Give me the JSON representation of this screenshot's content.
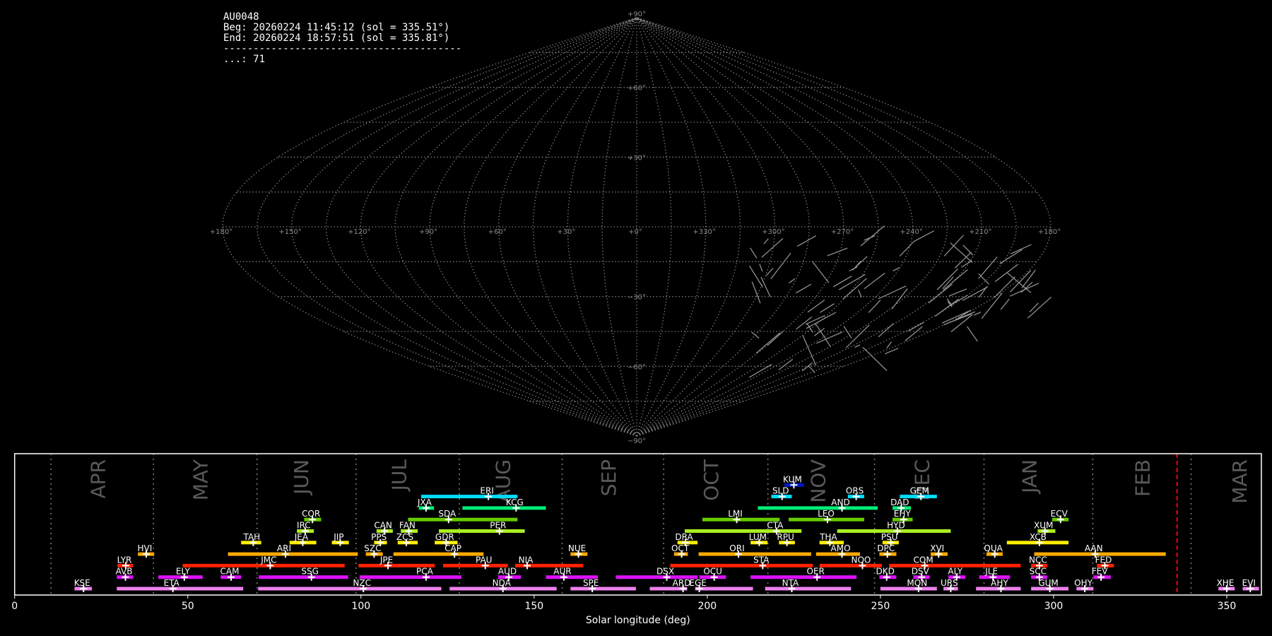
{
  "header": {
    "station": "AU0048",
    "begin": "Beg: 20260224 11:45:12 (sol = 335.51°)",
    "end": "End: 20260224 18:57:51 (sol = 335.81°)",
    "separator": "----------------------------------------",
    "count": "...: 71"
  },
  "sky_map": {
    "projection": "sinusoidal",
    "lon_labels": [
      {
        "lon": 180,
        "text": "+180°",
        "side": "left"
      },
      {
        "lon": 150,
        "text": "+150°"
      },
      {
        "lon": 120,
        "text": "+120°"
      },
      {
        "lon": 90,
        "text": "+90°"
      },
      {
        "lon": 60,
        "text": "+60°"
      },
      {
        "lon": 30,
        "text": "+30°"
      },
      {
        "lon": 0,
        "text": "+0°"
      },
      {
        "lon": 330,
        "text": "+330°"
      },
      {
        "lon": 300,
        "text": "+300°"
      },
      {
        "lon": 270,
        "text": "+270°"
      },
      {
        "lon": 240,
        "text": "+240°"
      },
      {
        "lon": 210,
        "text": "+210°"
      },
      {
        "lon": 180,
        "text": "+180°",
        "side": "right"
      }
    ],
    "lat_labels": [
      {
        "lat": 90,
        "text": "+90°"
      },
      {
        "lat": 60,
        "text": "+60°"
      },
      {
        "lat": 30,
        "text": "+30°"
      },
      {
        "lat": -30,
        "text": "−30°"
      },
      {
        "lat": -60,
        "text": "−60°"
      },
      {
        "lat": -90,
        "text": "−90°"
      }
    ],
    "grid_color": "#8a8a8a"
  },
  "chart_data": {
    "type": "bar",
    "xlabel": "Solar longitude (deg)",
    "xlim": [
      0,
      360
    ],
    "xticks": [
      0,
      50,
      100,
      150,
      200,
      250,
      300,
      350
    ],
    "month_boundaries": [
      10.5,
      40.1,
      70.0,
      98.6,
      128.4,
      158.1,
      187.4,
      217.5,
      248.3,
      279.9,
      311.3,
      339.7
    ],
    "months": [
      {
        "name": "APR",
        "sol": 24
      },
      {
        "name": "MAY",
        "sol": 53.6
      },
      {
        "name": "JUN",
        "sol": 82.7
      },
      {
        "name": "JUL",
        "sol": 111
      },
      {
        "name": "AUG",
        "sol": 141
      },
      {
        "name": "SEP",
        "sol": 171.5
      },
      {
        "name": "OCT",
        "sol": 201
      },
      {
        "name": "NOV",
        "sol": 232
      },
      {
        "name": "DEC",
        "sol": 262
      },
      {
        "name": "JAN",
        "sol": 293
      },
      {
        "name": "FEB",
        "sol": 325.6
      },
      {
        "name": "MAR",
        "sol": 353.7
      }
    ],
    "observation_marker": {
      "sol": 335.66,
      "color": "#ff0000"
    },
    "row_colors": [
      "#ee82ee",
      "#dd11ff",
      "#ff2200",
      "#ffaa00",
      "#ffee00",
      "#aaee22",
      "#66cc00",
      "#00ee77",
      "#00ddff",
      "#0018cc"
    ],
    "showers": [
      {
        "name": "KSE",
        "row": 0,
        "start": 17.3,
        "end": 22.3,
        "peak": 19.9
      },
      {
        "name": "ETA",
        "row": 0,
        "start": 29.5,
        "end": 66,
        "peak": 45.7
      },
      {
        "name": "NZC",
        "row": 0,
        "start": 70.3,
        "end": 123.2,
        "peak": 100.7
      },
      {
        "name": "NDA",
        "row": 0,
        "start": 125.6,
        "end": 156.5,
        "peak": 141
      },
      {
        "name": "SPE",
        "row": 0,
        "start": 160.5,
        "end": 179.4,
        "peak": 166.8
      },
      {
        "name": "ARD",
        "row": 0,
        "start": 183.4,
        "end": 194.2,
        "peak": 193
      },
      {
        "name": "EGE",
        "row": 0,
        "start": 196.5,
        "end": 213.2,
        "peak": 197.7
      },
      {
        "name": "NTA",
        "row": 0,
        "start": 216.7,
        "end": 241.5,
        "peak": 224.4
      },
      {
        "name": "MON",
        "row": 0,
        "start": 250,
        "end": 266.3,
        "peak": 261
      },
      {
        "name": "URS",
        "row": 0,
        "start": 268.2,
        "end": 272.4,
        "peak": 270.3
      },
      {
        "name": "AHY",
        "row": 0,
        "start": 277.6,
        "end": 290.5,
        "peak": 284.8
      },
      {
        "name": "GUM",
        "row": 0,
        "start": 293.5,
        "end": 304.3,
        "peak": 298.9
      },
      {
        "name": "OHY",
        "row": 0,
        "start": 306.6,
        "end": 311.5,
        "peak": 309
      },
      {
        "name": "XHE",
        "row": 0,
        "start": 347.6,
        "end": 352.3,
        "peak": 350
      },
      {
        "name": "EVI",
        "row": 0,
        "start": 354.6,
        "end": 359.3,
        "peak": 356.8
      },
      {
        "name": "AVB",
        "row": 1,
        "start": 29.5,
        "end": 34.2,
        "peak": 32
      },
      {
        "name": "ELY",
        "row": 1,
        "start": 41.5,
        "end": 54.3,
        "peak": 49
      },
      {
        "name": "CAM",
        "row": 1,
        "start": 59.5,
        "end": 65.4,
        "peak": 62.5
      },
      {
        "name": "SSG",
        "row": 1,
        "start": 70.5,
        "end": 96.3,
        "peak": 85.7
      },
      {
        "name": "PCA",
        "row": 1,
        "start": 99.6,
        "end": 129,
        "peak": 118.8
      },
      {
        "name": "AUD",
        "row": 1,
        "start": 139.6,
        "end": 146.2,
        "peak": 142.7
      },
      {
        "name": "AUR",
        "row": 1,
        "start": 153.4,
        "end": 168.4,
        "peak": 158.6
      },
      {
        "name": "DSX",
        "row": 1,
        "start": 173.6,
        "end": 197.2,
        "peak": 188.3
      },
      {
        "name": "OCU",
        "row": 1,
        "start": 197.7,
        "end": 205.4,
        "peak": 202
      },
      {
        "name": "OER",
        "row": 1,
        "start": 212.5,
        "end": 243.1,
        "peak": 231.7
      },
      {
        "name": "DKD",
        "row": 1,
        "start": 249.7,
        "end": 254.6,
        "peak": 251.8
      },
      {
        "name": "DSV",
        "row": 1,
        "start": 259.5,
        "end": 264.2,
        "peak": 261.9
      },
      {
        "name": "ALY",
        "row": 1,
        "start": 269.6,
        "end": 274.5,
        "peak": 272
      },
      {
        "name": "JLE",
        "row": 1,
        "start": 278.5,
        "end": 287.4,
        "peak": 282.5
      },
      {
        "name": "SCC",
        "row": 1,
        "start": 293.5,
        "end": 298.2,
        "peak": 295.9
      },
      {
        "name": "FEV",
        "row": 1,
        "start": 311.5,
        "end": 316.5,
        "peak": 313.7
      },
      {
        "name": "LYR",
        "row": 2,
        "start": 29.7,
        "end": 34.2,
        "peak": 32.1
      },
      {
        "name": "JMC",
        "row": 2,
        "start": 48.5,
        "end": 95.3,
        "peak": 73.8
      },
      {
        "name": "JPE",
        "row": 2,
        "start": 99.3,
        "end": 121.3,
        "peak": 107.8
      },
      {
        "name": "PAU",
        "row": 2,
        "start": 123.7,
        "end": 142.4,
        "peak": 135.9
      },
      {
        "name": "NIA",
        "row": 2,
        "start": 144.5,
        "end": 164.2,
        "peak": 148
      },
      {
        "name": "STA",
        "row": 2,
        "start": 189.3,
        "end": 230.5,
        "peak": 216
      },
      {
        "name": "NOO",
        "row": 2,
        "start": 232.4,
        "end": 250.4,
        "peak": 244.8
      },
      {
        "name": "COM",
        "row": 2,
        "start": 252.5,
        "end": 290.5,
        "peak": 262.8
      },
      {
        "name": "NCC",
        "row": 2,
        "start": 293.5,
        "end": 298.2,
        "peak": 295.9
      },
      {
        "name": "FED",
        "row": 2,
        "start": 312.5,
        "end": 317.4,
        "peak": 314.8
      },
      {
        "name": "HVI",
        "row": 3,
        "start": 35.6,
        "end": 40.3,
        "peak": 38
      },
      {
        "name": "ARI",
        "row": 3,
        "start": 61.6,
        "end": 99.1,
        "peak": 78.2
      },
      {
        "name": "SZC",
        "row": 3,
        "start": 101.4,
        "end": 106.3,
        "peak": 103.8
      },
      {
        "name": "CAP",
        "row": 3,
        "start": 109.4,
        "end": 135.4,
        "peak": 127
      },
      {
        "name": "NUE",
        "row": 3,
        "start": 160.5,
        "end": 165.4,
        "peak": 162.8
      },
      {
        "name": "OCT",
        "row": 3,
        "start": 190.4,
        "end": 194.4,
        "peak": 192.6
      },
      {
        "name": "ORI",
        "row": 3,
        "start": 197.5,
        "end": 230,
        "peak": 209
      },
      {
        "name": "AMO",
        "row": 3,
        "start": 231.4,
        "end": 244.1,
        "peak": 238.9
      },
      {
        "name": "DPC",
        "row": 3,
        "start": 249.7,
        "end": 254.6,
        "peak": 252
      },
      {
        "name": "XVI",
        "row": 3,
        "start": 264.5,
        "end": 269.4,
        "peak": 266.8
      },
      {
        "name": "QUA",
        "row": 3,
        "start": 280.6,
        "end": 285.3,
        "peak": 283
      },
      {
        "name": "AAN",
        "row": 3,
        "start": 294.4,
        "end": 332.4,
        "peak": 312
      },
      {
        "name": "TAH",
        "row": 4,
        "start": 65.4,
        "end": 71.2,
        "peak": 68.9
      },
      {
        "name": "JEA",
        "row": 4,
        "start": 79.4,
        "end": 87.1,
        "peak": 83.2
      },
      {
        "name": "JIP",
        "row": 4,
        "start": 91.6,
        "end": 96.5,
        "peak": 94
      },
      {
        "name": "PPS",
        "row": 4,
        "start": 103.8,
        "end": 107.5,
        "peak": 105.6
      },
      {
        "name": "ZCS",
        "row": 4,
        "start": 110.6,
        "end": 116.4,
        "peak": 113.1
      },
      {
        "name": "GDR",
        "row": 4,
        "start": 121.3,
        "end": 127.9,
        "peak": 124.6
      },
      {
        "name": "DRA",
        "row": 4,
        "start": 191.4,
        "end": 197.2,
        "peak": 193.7
      },
      {
        "name": "LUM",
        "row": 4,
        "start": 212.5,
        "end": 217.4,
        "peak": 215
      },
      {
        "name": "RPU",
        "row": 4,
        "start": 220.7,
        "end": 225.3,
        "peak": 223
      },
      {
        "name": "THA",
        "row": 4,
        "start": 232.4,
        "end": 239.4,
        "peak": 235.4
      },
      {
        "name": "PSU",
        "row": 4,
        "start": 250.6,
        "end": 255.3,
        "peak": 253
      },
      {
        "name": "XCB",
        "row": 4,
        "start": 286.5,
        "end": 304.3,
        "peak": 295.9
      },
      {
        "name": "IRC",
        "row": 5,
        "start": 81.5,
        "end": 86.4,
        "peak": 83.9
      },
      {
        "name": "CAN",
        "row": 5,
        "start": 104.5,
        "end": 109.2,
        "peak": 106.8
      },
      {
        "name": "FAN",
        "row": 5,
        "start": 111.5,
        "end": 116.4,
        "peak": 113.8
      },
      {
        "name": "PER",
        "row": 5,
        "start": 122.5,
        "end": 147.3,
        "peak": 140
      },
      {
        "name": "CTA",
        "row": 5,
        "start": 193.5,
        "end": 227.2,
        "peak": 220
      },
      {
        "name": "HYD",
        "row": 5,
        "start": 237.5,
        "end": 270.3,
        "peak": 254.9
      },
      {
        "name": "XUM",
        "row": 5,
        "start": 295.4,
        "end": 300.5,
        "peak": 297.5
      },
      {
        "name": "COR",
        "row": 6,
        "start": 83.6,
        "end": 88.5,
        "peak": 86
      },
      {
        "name": "SDA",
        "row": 6,
        "start": 113.6,
        "end": 145.2,
        "peak": 125.3
      },
      {
        "name": "LMI",
        "row": 6,
        "start": 198.6,
        "end": 220.9,
        "peak": 208.5
      },
      {
        "name": "LEO",
        "row": 6,
        "start": 223.5,
        "end": 245.3,
        "peak": 234.7
      },
      {
        "name": "EHY",
        "row": 6,
        "start": 253.5,
        "end": 259.3,
        "peak": 256.7
      },
      {
        "name": "ECV",
        "row": 6,
        "start": 299.6,
        "end": 304.3,
        "peak": 302
      },
      {
        "name": "JXA",
        "row": 7,
        "start": 116.7,
        "end": 121.1,
        "peak": 118.8
      },
      {
        "name": "KCG",
        "row": 7,
        "start": 129.3,
        "end": 153.4,
        "peak": 144.8
      },
      {
        "name": "AND",
        "row": 7,
        "start": 214.6,
        "end": 249.2,
        "peak": 238.9
      },
      {
        "name": "DAD",
        "row": 7,
        "start": 253.5,
        "end": 258.8,
        "peak": 256
      },
      {
        "name": "ERI",
        "row": 8,
        "start": 117.4,
        "end": 145.2,
        "peak": 136.8
      },
      {
        "name": "SLD",
        "row": 8,
        "start": 218.5,
        "end": 224.4,
        "peak": 221.6
      },
      {
        "name": "ORS",
        "row": 8,
        "start": 240.6,
        "end": 245.3,
        "peak": 243
      },
      {
        "name": "GEM",
        "row": 8,
        "start": 255.6,
        "end": 266.3,
        "peak": 261.7
      },
      {
        "name": "KUM",
        "row": 9,
        "start": 222.3,
        "end": 227.9,
        "peak": 225
      }
    ]
  }
}
